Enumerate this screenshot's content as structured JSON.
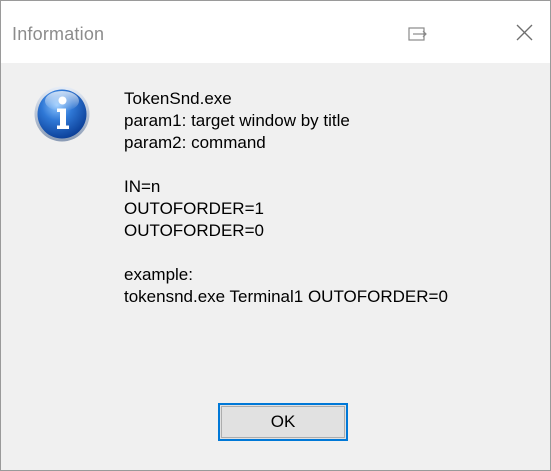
{
  "window": {
    "title": "Information"
  },
  "message": {
    "lines": [
      "TokenSnd.exe",
      "param1: target window by title",
      "param2: command",
      "",
      "IN=n",
      "OUTOFORDER=1",
      "OUTOFORDER=0",
      "",
      "example:",
      "tokensnd.exe Terminal1 OUTOFORDER=0"
    ]
  },
  "buttons": {
    "ok_label": "OK"
  },
  "colors": {
    "accent": "#0078d7",
    "content_bg": "#f0f0f0",
    "button_bg": "#e1e1e1",
    "title_text": "#8c8c8c"
  },
  "icons": {
    "message_icon": "information-icon",
    "titlebar_left": "restore-window-icon",
    "titlebar_right": "close-icon"
  }
}
